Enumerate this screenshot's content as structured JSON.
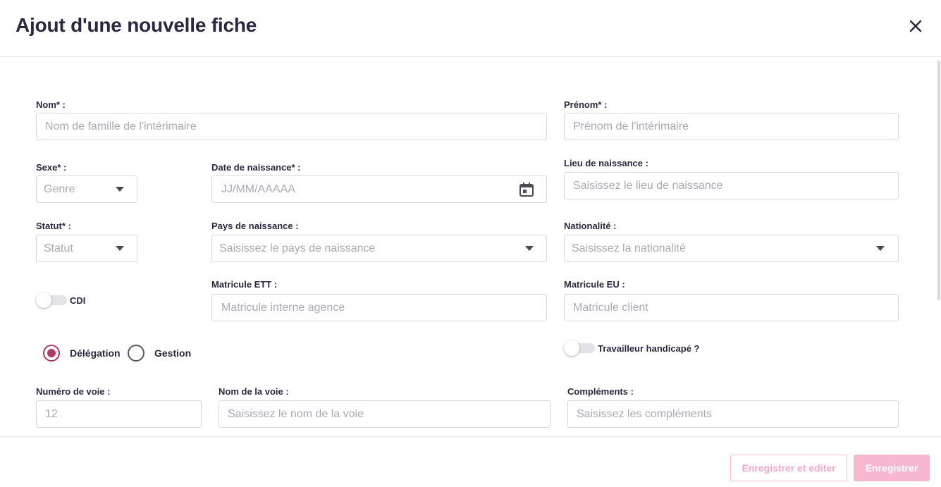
{
  "modal": {
    "title": "Ajout d'une nouvelle fiche"
  },
  "fields": {
    "nom": {
      "label": "Nom* :",
      "placeholder": "Nom de famille de l'intérimaire"
    },
    "prenom": {
      "label": "Prénom* :",
      "placeholder": "Prénom de l'intérimaire"
    },
    "sexe": {
      "label": "Sexe* :",
      "placeholder": "Genre"
    },
    "date_naissance": {
      "label": "Date de naissance* :",
      "placeholder": "JJ/MM/AAAAA"
    },
    "lieu_naissance": {
      "label": "Lieu de naissance :",
      "placeholder": "Saisissez le lieu de naissance"
    },
    "statut": {
      "label": "Statut* :",
      "placeholder": "Statut"
    },
    "pays_naissance": {
      "label": "Pays de naissance :",
      "placeholder": "Saisissez le pays de naissance"
    },
    "nationalite": {
      "label": "Nationalité :",
      "placeholder": "Saisissez la nationalité"
    },
    "cdi": {
      "label": "CDI",
      "checked": false
    },
    "matricule_ett": {
      "label": "Matricule ETT :",
      "placeholder": "Matricule interne agence"
    },
    "matricule_eu": {
      "label": "Matricule EU :",
      "placeholder": "Matricule client"
    },
    "mode": {
      "options": [
        {
          "label": "Délégation",
          "selected": true
        },
        {
          "label": "Gestion",
          "selected": false
        }
      ]
    },
    "travailleur_handicape": {
      "label": "Travailleur handicapé ?",
      "checked": false
    },
    "numero_voie": {
      "label": "Numéro de voie :",
      "placeholder": "12"
    },
    "nom_voie": {
      "label": "Nom de la voie :",
      "placeholder": "Saisissez le nom de la voie"
    },
    "complements": {
      "label": "Compléments :",
      "placeholder": "Saisissez les compléments"
    }
  },
  "footer": {
    "save_edit_label": "Enregistrer et editer",
    "save_label": "Enregistrer"
  },
  "colors": {
    "accent": "#b23a62",
    "button_pink": "#f7b8cf",
    "button_text_pink": "#f4a6c3"
  },
  "icons": {
    "close": "close-icon",
    "calendar": "calendar-icon",
    "dropdown": "chevron-down-icon"
  }
}
